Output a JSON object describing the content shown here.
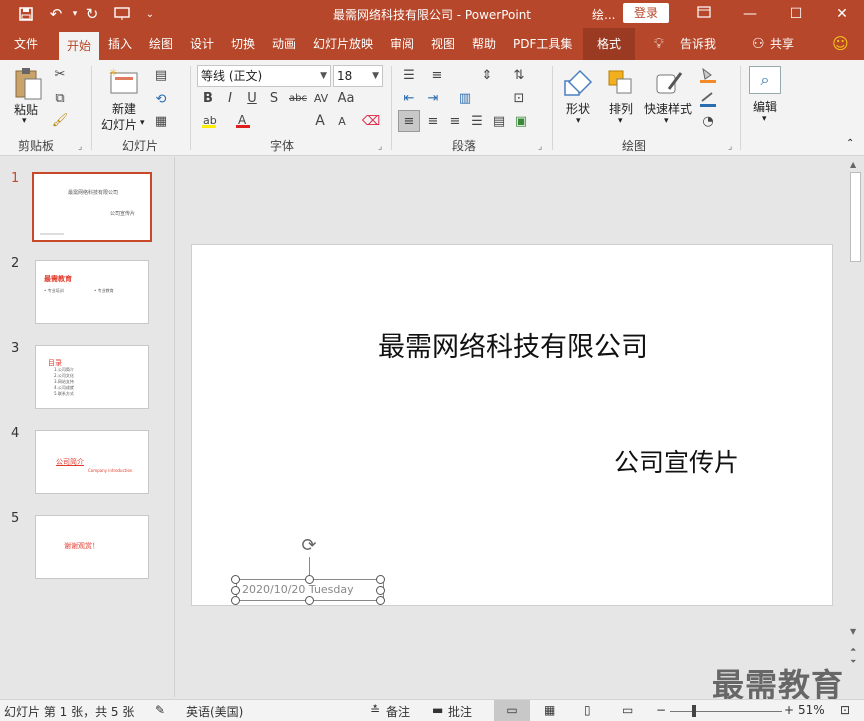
{
  "titlebar": {
    "doc_title": "最需网络科技有限公司  -  PowerPoint",
    "context_tools": "绘...",
    "login": "登录",
    "icons": [
      "save-icon",
      "undo-icon",
      "redo-icon",
      "present-icon",
      "customize-icon",
      "ribbon-display-icon",
      "minimize-icon",
      "maximize-icon",
      "close-icon"
    ]
  },
  "tabs": [
    "文件",
    "开始",
    "插入",
    "绘图",
    "设计",
    "切换",
    "动画",
    "幻灯片放映",
    "审阅",
    "视图",
    "帮助",
    "PDF工具集",
    "格式"
  ],
  "tell_me": "告诉我",
  "share": "共享",
  "ribbon": {
    "clipboard": {
      "paste": "粘贴",
      "group": "剪贴板"
    },
    "slides": {
      "new_slide_line1": "新建",
      "new_slide_line2": "幻灯片",
      "group": "幻灯片"
    },
    "font": {
      "name": "等线 (正文)",
      "size": "18",
      "group": "字体"
    },
    "paragraph": {
      "group": "段落"
    },
    "drawing": {
      "shape": "形状",
      "arrange": "排列",
      "quick_styles": "快速样式",
      "group": "绘图"
    },
    "editing": {
      "label": "编辑"
    }
  },
  "thumbnails": [
    {
      "num": "1",
      "title": "最需网络科技有限公司",
      "subtitle": "公司宣传片"
    },
    {
      "num": "2",
      "title": "最需教育",
      "items": [
        "• 专业培训",
        "• 专业教育"
      ]
    },
    {
      "num": "3",
      "title": "目录",
      "items": [
        "1.公司简介",
        "2.公司文化",
        "3.网站支持",
        "4.公司成就",
        "5.联系方式"
      ]
    },
    {
      "num": "4",
      "title": "公司简介",
      "subtitle": "Company introduction"
    },
    {
      "num": "5",
      "title": "谢谢观赏！"
    }
  ],
  "slide": {
    "title": "最需网络科技有限公司",
    "subtitle": "公司宣传片",
    "date": "2020/10/20 Tuesday"
  },
  "status": {
    "slide_info": "幻灯片 第 1 张，共 5 张",
    "language": "英语(美国)",
    "notes": "备注",
    "comments": "批注",
    "zoom": "51%"
  },
  "watermark": "最需教育",
  "colors": {
    "accent": "#b7472a",
    "red_text": "#e23b2e"
  }
}
